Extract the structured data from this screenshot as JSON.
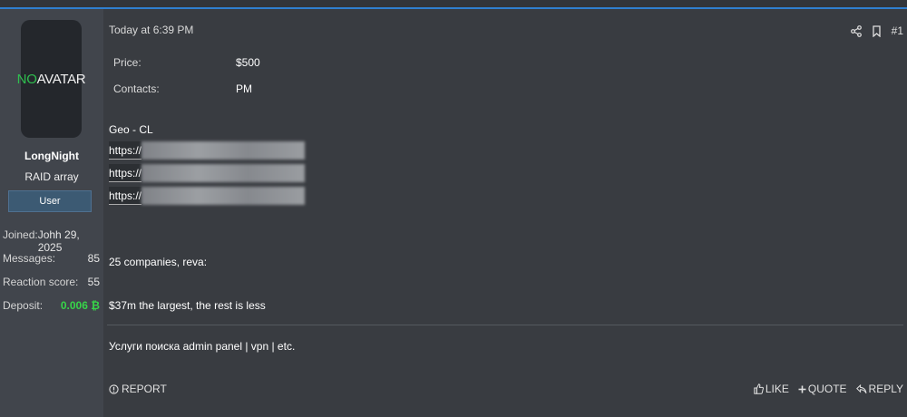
{
  "author": {
    "avatar_text_no": "NO",
    "avatar_text_avatar": "AVATAR",
    "username": "LongNight",
    "title": "RAID array",
    "badge": "User",
    "stats": [
      {
        "label": "Joined:",
        "value": "Johh 29, 2025"
      },
      {
        "label": "Messages:",
        "value": "85"
      },
      {
        "label": "Reaction score:",
        "value": "55"
      },
      {
        "label": "Deposit:",
        "value": "0.006 ₿"
      }
    ]
  },
  "post": {
    "timestamp": "Today at 6:39 PM",
    "post_number": "#1",
    "fields": [
      {
        "label": "Price:",
        "value": "$500"
      },
      {
        "label": "Contacts:",
        "value": "PM"
      }
    ],
    "geo": "Geo - CL",
    "links": [
      "https://",
      "https://",
      "https://"
    ],
    "companies": "25 companies, reva:",
    "largest": "$37m the largest, the rest is less",
    "signature": "Услуги поиска admin panel | vpn | etc."
  },
  "actions": {
    "report": "REPORT",
    "like": "LIKE",
    "quote": "QUOTE",
    "reply": "REPLY"
  },
  "colors": {
    "accent_blue": "#2f7fd0",
    "deposit_green": "#37d449",
    "badge_bg": "#3c5a73"
  }
}
